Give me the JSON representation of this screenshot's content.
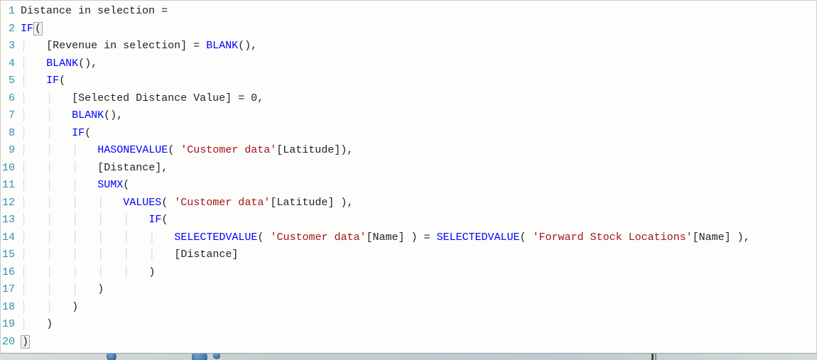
{
  "editor": {
    "language": "DAX",
    "lines": [
      {
        "n": 1,
        "indent": 0,
        "tokens": [
          [
            "plain",
            "Distance in selection ="
          ]
        ]
      },
      {
        "n": 2,
        "indent": 0,
        "tokens": [
          [
            "kw",
            "IF"
          ],
          [
            "plain",
            "("
          ]
        ],
        "cursorAfter": true
      },
      {
        "n": 3,
        "indent": 1,
        "tokens": [
          [
            "plain",
            "[Revenue in selection] = "
          ],
          [
            "kw",
            "BLANK"
          ],
          [
            "plain",
            "(),"
          ]
        ]
      },
      {
        "n": 4,
        "indent": 1,
        "tokens": [
          [
            "kw",
            "BLANK"
          ],
          [
            "plain",
            "(),"
          ]
        ]
      },
      {
        "n": 5,
        "indent": 1,
        "tokens": [
          [
            "kw",
            "IF"
          ],
          [
            "plain",
            "("
          ]
        ]
      },
      {
        "n": 6,
        "indent": 2,
        "tokens": [
          [
            "plain",
            "[Selected Distance Value] = 0,"
          ]
        ]
      },
      {
        "n": 7,
        "indent": 2,
        "tokens": [
          [
            "kw",
            "BLANK"
          ],
          [
            "plain",
            "(),"
          ]
        ]
      },
      {
        "n": 8,
        "indent": 2,
        "tokens": [
          [
            "kw",
            "IF"
          ],
          [
            "plain",
            "("
          ]
        ]
      },
      {
        "n": 9,
        "indent": 3,
        "tokens": [
          [
            "kw",
            "HASONEVALUE"
          ],
          [
            "plain",
            "( "
          ],
          [
            "str",
            "'Customer data'"
          ],
          [
            "plain",
            "[Latitude]),"
          ]
        ]
      },
      {
        "n": 10,
        "indent": 3,
        "tokens": [
          [
            "plain",
            "[Distance],"
          ]
        ]
      },
      {
        "n": 11,
        "indent": 3,
        "tokens": [
          [
            "kw",
            "SUMX"
          ],
          [
            "plain",
            "("
          ]
        ]
      },
      {
        "n": 12,
        "indent": 4,
        "tokens": [
          [
            "kw",
            "VALUES"
          ],
          [
            "plain",
            "( "
          ],
          [
            "str",
            "'Customer data'"
          ],
          [
            "plain",
            "[Latitude] ),"
          ]
        ]
      },
      {
        "n": 13,
        "indent": 5,
        "tokens": [
          [
            "kw",
            "IF"
          ],
          [
            "plain",
            "("
          ]
        ]
      },
      {
        "n": 14,
        "indent": 6,
        "tokens": [
          [
            "kw",
            "SELECTEDVALUE"
          ],
          [
            "plain",
            "( "
          ],
          [
            "str",
            "'Customer data'"
          ],
          [
            "plain",
            "[Name] ) = "
          ],
          [
            "kw",
            "SELECTEDVALUE"
          ],
          [
            "plain",
            "( "
          ],
          [
            "str",
            "'Forward Stock Locations'"
          ],
          [
            "plain",
            "[Name] ),"
          ]
        ]
      },
      {
        "n": 15,
        "indent": 6,
        "tokens": [
          [
            "plain",
            "[Distance]"
          ]
        ]
      },
      {
        "n": 16,
        "indent": 5,
        "tokens": [
          [
            "plain",
            ")"
          ]
        ]
      },
      {
        "n": 17,
        "indent": 3,
        "tokens": [
          [
            "plain",
            ")"
          ]
        ]
      },
      {
        "n": 18,
        "indent": 2,
        "tokens": [
          [
            "plain",
            ")"
          ]
        ]
      },
      {
        "n": 19,
        "indent": 1,
        "tokens": [
          [
            "plain",
            ")"
          ]
        ]
      },
      {
        "n": 20,
        "indent": 0,
        "tokens": [
          [
            "plain",
            ")"
          ]
        ],
        "matchHighlight": true
      }
    ]
  }
}
